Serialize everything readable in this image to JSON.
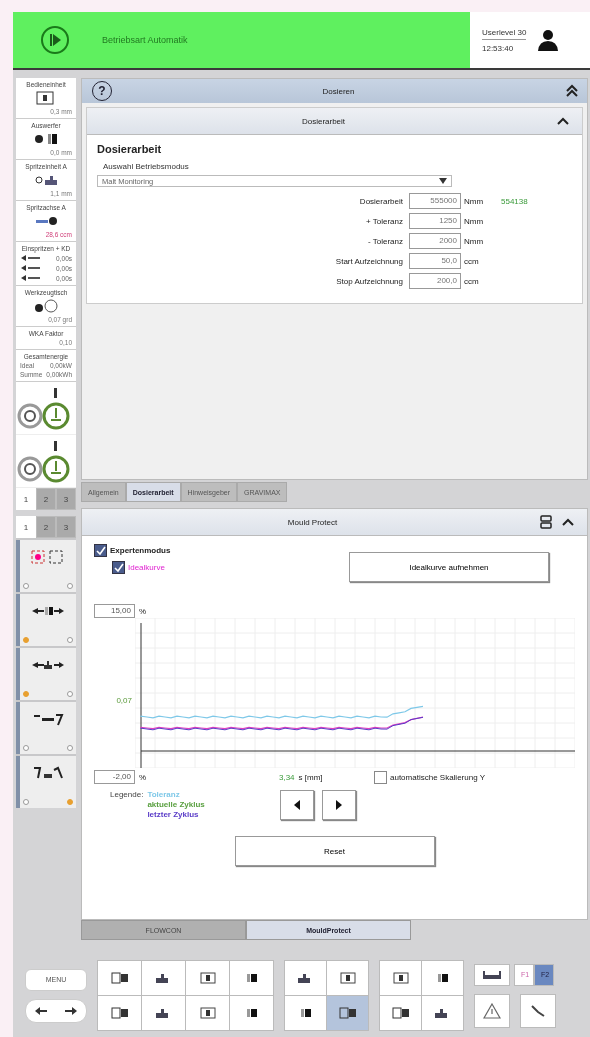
{
  "header": {
    "mode": "Betriebsart Automatik",
    "userlevel": "Userlevel 30",
    "time": "12:53:40"
  },
  "sidebar": {
    "items": [
      {
        "kind": "single",
        "title": "Bedieneinheit",
        "value": "0,3 mm",
        "highlight": false
      },
      {
        "kind": "single",
        "title": "Auswerfer",
        "value": "0,0 mm",
        "highlight": false
      },
      {
        "kind": "single",
        "title": "Spritzeinheit A",
        "value": "1,1 mm",
        "highlight": false
      },
      {
        "kind": "single",
        "title": "Spritzachse A",
        "value": "28,6 ccm",
        "highlight": true
      },
      {
        "kind": "rows",
        "title": "Einspritzen + KD",
        "rows": [
          {
            "label": "",
            "value": "0,00s"
          },
          {
            "label": "",
            "value": "0,00s"
          },
          {
            "label": "",
            "value": "0,00s"
          }
        ]
      },
      {
        "kind": "single",
        "title": "Werkzeugtisch",
        "value": "0,07 grd",
        "highlight": false
      },
      {
        "kind": "single",
        "title": "WKA Faktor",
        "value": "0,10",
        "highlight": false
      },
      {
        "kind": "rows",
        "title": "Gesamtenergie",
        "rows": [
          {
            "label": "Ideal",
            "value": "0,00kW"
          },
          {
            "label": "Summe",
            "value": "0,00kWh"
          }
        ]
      }
    ],
    "widgets": [
      {
        "active": true
      },
      {
        "active": true
      }
    ],
    "tabs": [
      {
        "label": "1",
        "selected": true
      },
      {
        "label": "2",
        "selected": false
      },
      {
        "label": "3",
        "selected": false
      }
    ]
  },
  "side_panel": {
    "tabs": [
      {
        "label": "1",
        "selected": true
      },
      {
        "label": "2",
        "selected": false
      },
      {
        "label": "3",
        "selected": false
      }
    ],
    "buttons": [
      {
        "kind": "mould",
        "dots": [
          false,
          false
        ]
      },
      {
        "kind": "ejector",
        "dots": [
          true,
          false
        ]
      },
      {
        "kind": "injection",
        "dots": [
          true,
          false
        ]
      },
      {
        "kind": "core",
        "dots": [
          false,
          false
        ]
      },
      {
        "kind": "swap",
        "dots": [
          false,
          true
        ]
      }
    ]
  },
  "dosing": {
    "help": "?",
    "title": "Dosieren",
    "section": "Dosierarbeit",
    "heading": "Dosierarbeit",
    "mode_label": "Auswahl Betriebsmodus",
    "mode_value": "Malt Monitoring",
    "fields": [
      {
        "label": "Dosierarbeit",
        "value": "555000",
        "unit": "Nmm",
        "reading": "554138"
      },
      {
        "label": "+ Toleranz",
        "value": "1250",
        "unit": "Nmm"
      },
      {
        "label": "- Toleranz",
        "value": "2000",
        "unit": "Nmm"
      },
      {
        "label": "Start Aufzeichnung",
        "value": "50,0",
        "unit": "ccm"
      },
      {
        "label": "Stop Aufzeichnung",
        "value": "200,0",
        "unit": "ccm"
      }
    ]
  },
  "tabs": [
    {
      "label": "Allgemein",
      "selected": false
    },
    {
      "label": "Dosierarbeit",
      "selected": true
    },
    {
      "label": "Hinweisgeber",
      "selected": false
    },
    {
      "label": "GRAVIMAX",
      "selected": false
    }
  ],
  "mould": {
    "title": "Mould Protect",
    "expert": {
      "label": "Expertenmodus",
      "checked": true
    },
    "ideal": {
      "label": "Idealkurve",
      "checked": true
    },
    "record_button": "Idealkurve aufnehmen",
    "y_max": "15,00",
    "y_min": "-2,00",
    "y_unit": "%",
    "y_reading": "0,07",
    "x_reading": "3,34",
    "x_unit": "s [mm]",
    "autoscale": {
      "label": "automatische Skalierung Y",
      "checked": false
    },
    "legend_title": "Legende:",
    "legend": [
      {
        "label": "Toleranz",
        "color": "#7ec8e8"
      },
      {
        "label": "aktuelle Zyklus",
        "color": "#5aa040"
      },
      {
        "label": "letzter Zyklus",
        "color": "#5a3cc8"
      }
    ],
    "reset": "Reset"
  },
  "bottom_tabs": [
    {
      "label": "FLOWCON",
      "selected": false
    },
    {
      "label": "MouldProtect",
      "selected": true
    }
  ],
  "toolbar": {
    "menu": "MENU",
    "groups": [
      [
        {
          "selected": false
        },
        {
          "selected": false
        },
        {
          "selected": false
        },
        {
          "selected": false
        },
        {
          "selected": false
        },
        {
          "selected": false
        },
        {
          "selected": false
        },
        {
          "selected": false
        }
      ],
      [
        {
          "selected": false
        },
        {
          "selected": false
        },
        {
          "selected": false
        },
        {
          "selected": true
        }
      ],
      [
        {
          "selected": false
        },
        {
          "selected": false
        },
        {
          "selected": false
        },
        {
          "selected": false
        }
      ]
    ],
    "f_keys": [
      {
        "label": "F1",
        "selected": false
      },
      {
        "label": "F2",
        "selected": true
      }
    ]
  }
}
